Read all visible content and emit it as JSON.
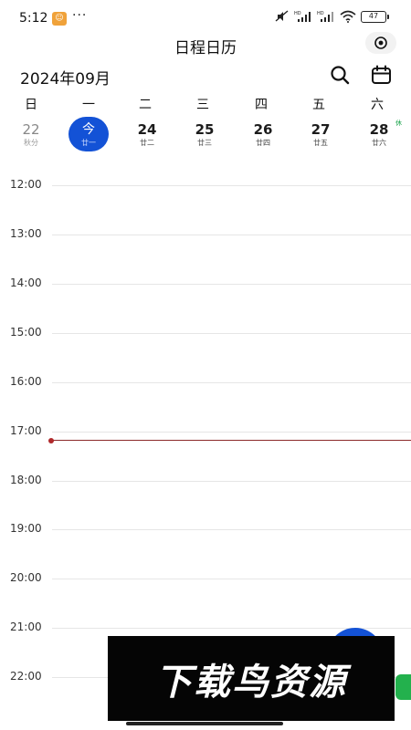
{
  "status_bar": {
    "time": "5:12",
    "notification_icon": "app-notification-icon",
    "dots": "···",
    "battery": "47",
    "icons": [
      "mute-icon",
      "hd-signal-icon",
      "hd-signal-icon",
      "wifi-icon",
      "battery-icon"
    ]
  },
  "header": {
    "title": "日程日历",
    "eye_icon": "eye-icon"
  },
  "toolbar": {
    "month": "2024年09月",
    "search_icon": "search-icon",
    "calendar_icon": "calendar-icon"
  },
  "week": {
    "weekdays": [
      "日",
      "一",
      "二",
      "三",
      "四",
      "五",
      "六"
    ],
    "dates": [
      {
        "num": "22",
        "sub": "秋分",
        "state": "past"
      },
      {
        "num": "今",
        "sub": "廿一",
        "state": "today"
      },
      {
        "num": "24",
        "sub": "廿二",
        "state": "normal"
      },
      {
        "num": "25",
        "sub": "廿三",
        "state": "normal"
      },
      {
        "num": "26",
        "sub": "廿四",
        "state": "normal"
      },
      {
        "num": "27",
        "sub": "廿五",
        "state": "normal"
      },
      {
        "num": "28",
        "sub": "廿六",
        "state": "normal"
      }
    ],
    "rest_tag": "休"
  },
  "timeline": {
    "hours": [
      "12:00",
      "13:00",
      "14:00",
      "15:00",
      "16:00",
      "17:00",
      "18:00",
      "19:00",
      "20:00",
      "21:00",
      "22:00"
    ]
  },
  "watermark": {
    "text": "下载鸟资源"
  },
  "colors": {
    "accent": "#1352d6",
    "now_line": "#8c2a2a",
    "rest_green": "#19a34a",
    "side_tab": "#23b14d"
  }
}
